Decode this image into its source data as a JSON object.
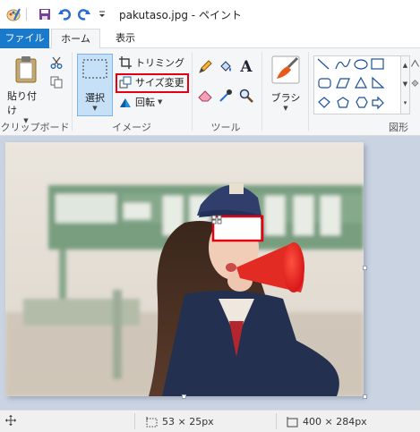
{
  "window": {
    "title": "pakutaso.jpg - ペイント"
  },
  "tabs": [
    {
      "label": "ファイル"
    },
    {
      "label": "ホーム"
    },
    {
      "label": "表示"
    }
  ],
  "ribbon": {
    "clipboard": {
      "paste_label": "貼り付け",
      "group_label": "クリップボード"
    },
    "image": {
      "select_label": "選択",
      "trim_label": "トリミング",
      "resize_label": "サイズ変更",
      "rotate_label": "回転",
      "group_label": "イメージ"
    },
    "tools": {
      "group_label": "ツール",
      "text_tool_glyph": "A"
    },
    "brush": {
      "label": "ブラシ"
    },
    "shapes": {
      "group_label": "図形"
    }
  },
  "colors": {
    "file_tab": "#1979ca",
    "highlight": "#e60012",
    "canvas_bg": "#c9d3e2",
    "selection": "#c5e0f7"
  },
  "status": {
    "selection_size": "53 × 25px",
    "image_size": "400 × 284px"
  }
}
